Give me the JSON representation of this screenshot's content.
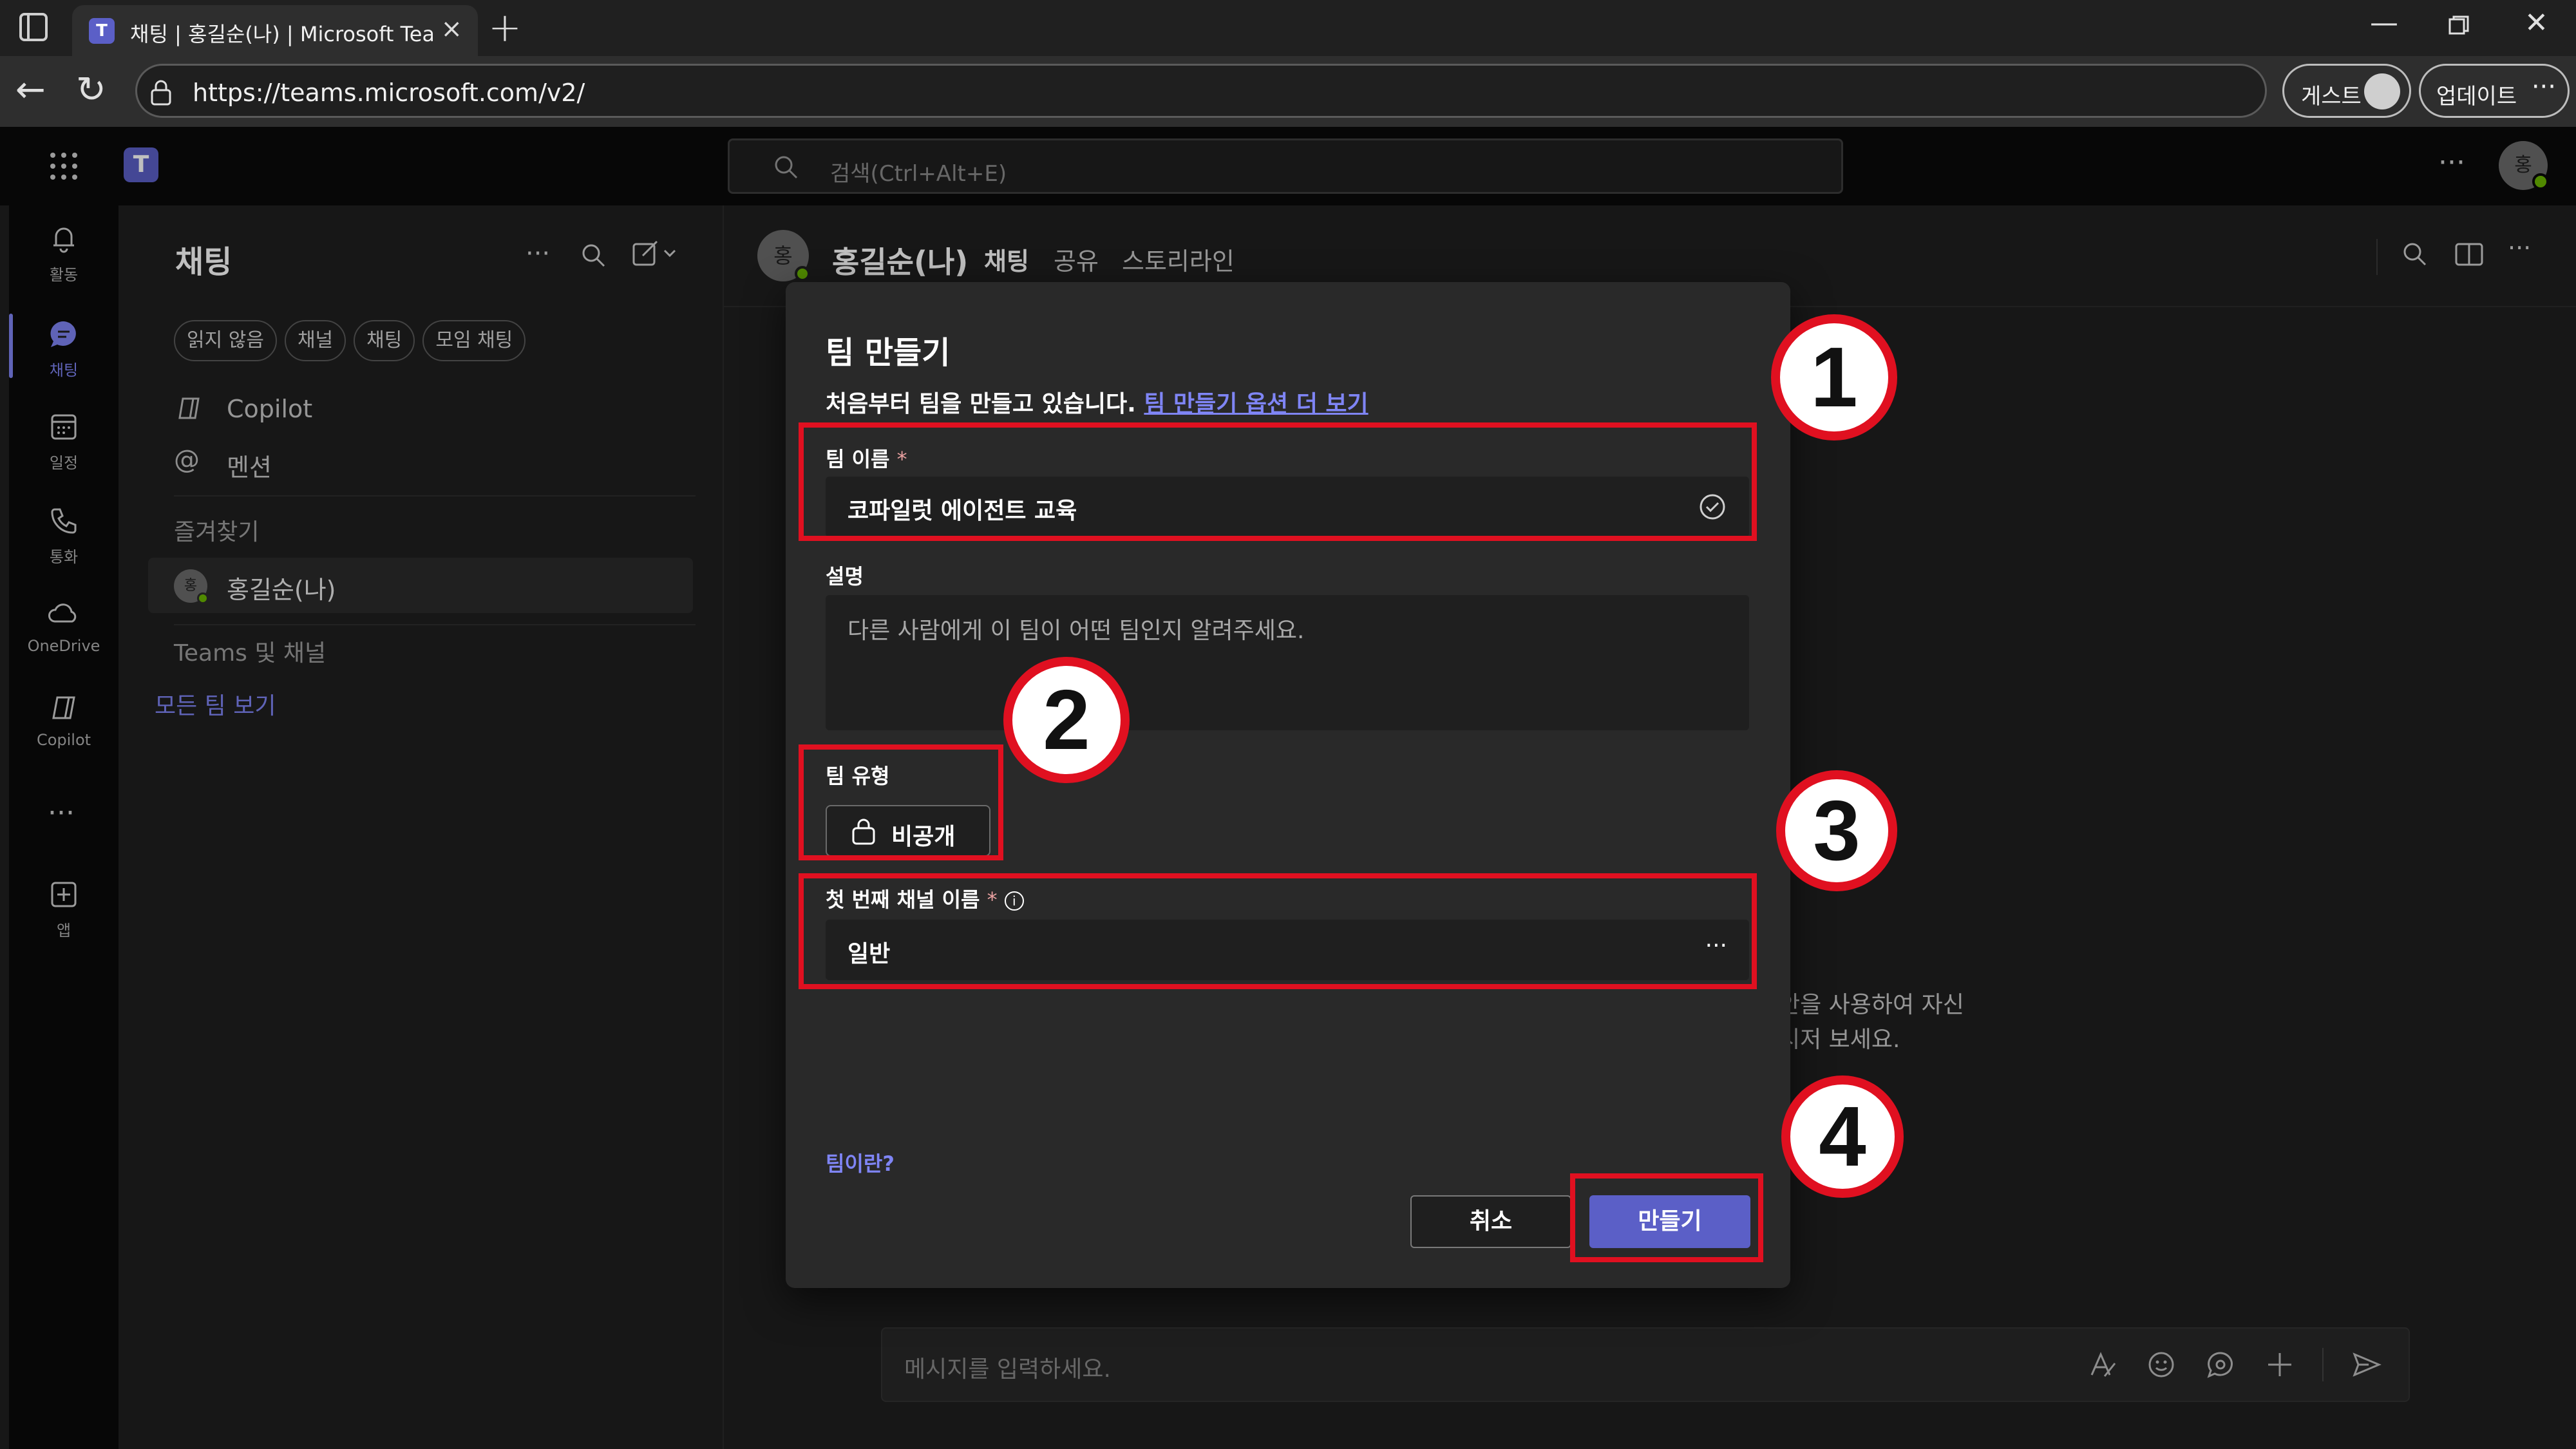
{
  "browser": {
    "tab_title": "채팅 | 홍길순(나) | Microsoft Teams",
    "url": "https://teams.microsoft.com/v2/",
    "guest_label": "게스트",
    "update_label": "업데이트"
  },
  "teams": {
    "search_placeholder": "검색(Ctrl+Alt+E)",
    "avatar_initial": "홍"
  },
  "rail": {
    "items": [
      {
        "label": "활동",
        "icon": "bell-icon"
      },
      {
        "label": "채팅",
        "icon": "chat-icon"
      },
      {
        "label": "일정",
        "icon": "calendar-icon"
      },
      {
        "label": "통화",
        "icon": "phone-icon"
      },
      {
        "label": "OneDrive",
        "icon": "cloud-icon"
      },
      {
        "label": "Copilot",
        "icon": "copilot-icon"
      },
      {
        "label": "앱",
        "icon": "apps-add-icon"
      }
    ],
    "active": "채팅"
  },
  "chatlist": {
    "title": "채팅",
    "filters": [
      "읽지 않음",
      "채널",
      "채팅",
      "모임 채팅"
    ],
    "copilot": "Copilot",
    "mentions": "멘션",
    "favorites": "즐겨찾기",
    "contact": "홍길순(나)",
    "contact_initial": "홍",
    "teams_channels": "Teams 및 채널",
    "all_teams": "모든 팀 보기"
  },
  "main": {
    "name": "홍길순(나)",
    "initial": "홍",
    "tabs": [
      "채팅",
      "공유",
      "스토리라인"
    ],
    "bg_line1": "안을 사용하여 자신",
    "bg_line2": "시저 보세요.",
    "message_placeholder": "메시지를 입력하세요."
  },
  "modal": {
    "title": "팀 만들기",
    "subtitle": "처음부터 팀을 만들고 있습니다.",
    "subtitle_link": "팀 만들기 옵션 더 보기",
    "team_name_label": "팀 이름",
    "required_mark": "*",
    "team_name_value": "코파일럿 에이전트 교육",
    "description_label": "설명",
    "description_placeholder": "다른 사람에게 이 팀이 어떤 팀인지 알려주세요.",
    "team_type_label": "팀 유형",
    "team_type_value": "비공개",
    "channel_label": "첫 번째 채널 이름",
    "channel_value": "일반",
    "what_is_team": "팀이란?",
    "cancel": "취소",
    "create": "만들기"
  },
  "annotations": {
    "badges": [
      "1",
      "2",
      "3",
      "4"
    ],
    "color": "#e01020"
  },
  "colors": {
    "accent": "#5b5fc7",
    "link": "#7f85f5",
    "presence": "#6bb700"
  }
}
